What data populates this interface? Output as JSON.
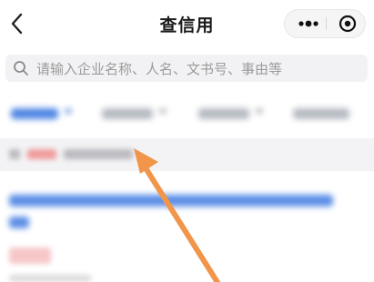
{
  "nav": {
    "title": "查信用"
  },
  "icons": {
    "back": "chevron-left-icon",
    "more": "more-dots-icon",
    "close": "target-close-icon",
    "search": "search-icon",
    "annotation": "arrow-icon"
  },
  "search": {
    "placeholder": "请输入企业名称、人名、文书号、事由等"
  },
  "colors": {
    "accent": "#3f7fe0",
    "annotation_arrow": "#f0954a",
    "tag_red": "#f08a8a"
  }
}
